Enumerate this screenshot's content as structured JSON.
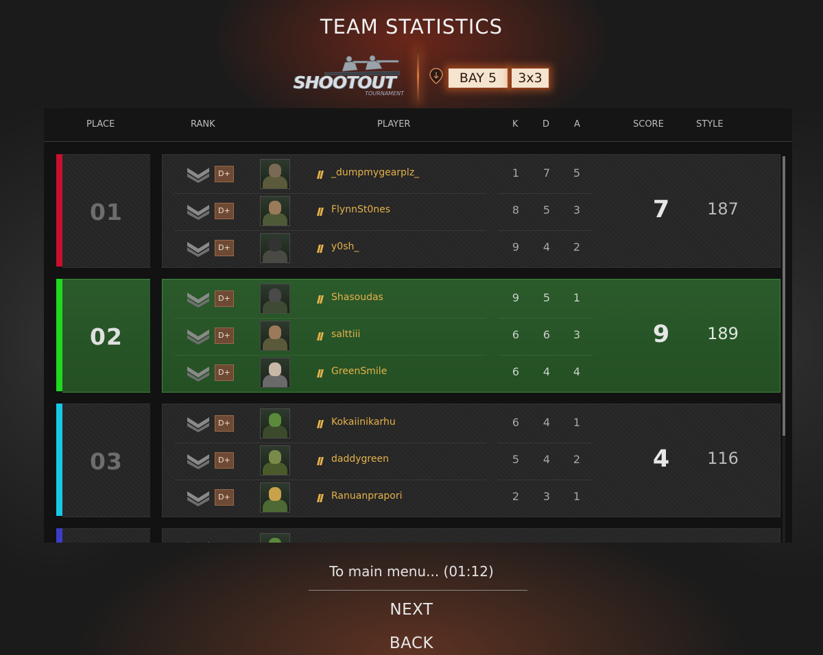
{
  "header": {
    "title": "TEAM STATISTICS"
  },
  "event": {
    "logo_word": "SHOOTOUT",
    "logo_sub": "TOURNAMENT",
    "location": "BAY 5",
    "mode": "3x3"
  },
  "table": {
    "columns": {
      "place": "PLACE",
      "rank": "RANK",
      "player": "PLAYER",
      "k": "K",
      "d": "D",
      "a": "A",
      "score": "SCORE",
      "style": "STYLE"
    }
  },
  "teams": [
    {
      "place": "01",
      "color": "#c8102e",
      "score": "7",
      "style": "187",
      "players": [
        {
          "rank_badge": "D+",
          "name": "_dumpmygearplz_",
          "k": "1",
          "d": "7",
          "a": "5",
          "face": "#7a6a55",
          "gear": "#5b5a3a"
        },
        {
          "rank_badge": "D+",
          "name": "FlynnSt0nes",
          "k": "8",
          "d": "5",
          "a": "3",
          "face": "#9a7a5a",
          "gear": "#4e5a36"
        },
        {
          "rank_badge": "D+",
          "name": "y0sh_",
          "k": "9",
          "d": "4",
          "a": "2",
          "face": "#333333",
          "gear": "#4a4a44"
        }
      ]
    },
    {
      "place": "02",
      "color": "#1fd81f",
      "score": "9",
      "style": "189",
      "players": [
        {
          "rank_badge": "D+",
          "name": "Shasoudas",
          "k": "9",
          "d": "5",
          "a": "1",
          "face": "#4a4a4a",
          "gear": "#3e4a34"
        },
        {
          "rank_badge": "D+",
          "name": "salttiii",
          "k": "6",
          "d": "6",
          "a": "3",
          "face": "#9a7a5a",
          "gear": "#5a5a3a"
        },
        {
          "rank_badge": "D+",
          "name": "GreenSmile",
          "k": "6",
          "d": "4",
          "a": "4",
          "face": "#c8b8a8",
          "gear": "#6a6a6a"
        }
      ]
    },
    {
      "place": "03",
      "color": "#16c8e6",
      "score": "4",
      "style": "116",
      "players": [
        {
          "rank_badge": "D+",
          "name": "Kokaiinikarhu",
          "k": "6",
          "d": "4",
          "a": "1",
          "face": "#5a8a3a",
          "gear": "#3a4a2a"
        },
        {
          "rank_badge": "D+",
          "name": "daddygreen",
          "k": "5",
          "d": "4",
          "a": "2",
          "face": "#7a8a4a",
          "gear": "#4a5a2a"
        },
        {
          "rank_badge": "D+",
          "name": "Ranuanprapori",
          "k": "2",
          "d": "3",
          "a": "1",
          "face": "#c8a24a",
          "gear": "#4e6a34"
        }
      ]
    },
    {
      "color": "#3c3cc8",
      "players": [
        {
          "rank_badge": "",
          "face": "#5a8a3a",
          "gear": "#3a4a2a"
        }
      ]
    }
  ],
  "footer": {
    "countdown": "To main menu... (01:12)",
    "next_label": "NEXT",
    "back_label": "BACK"
  }
}
